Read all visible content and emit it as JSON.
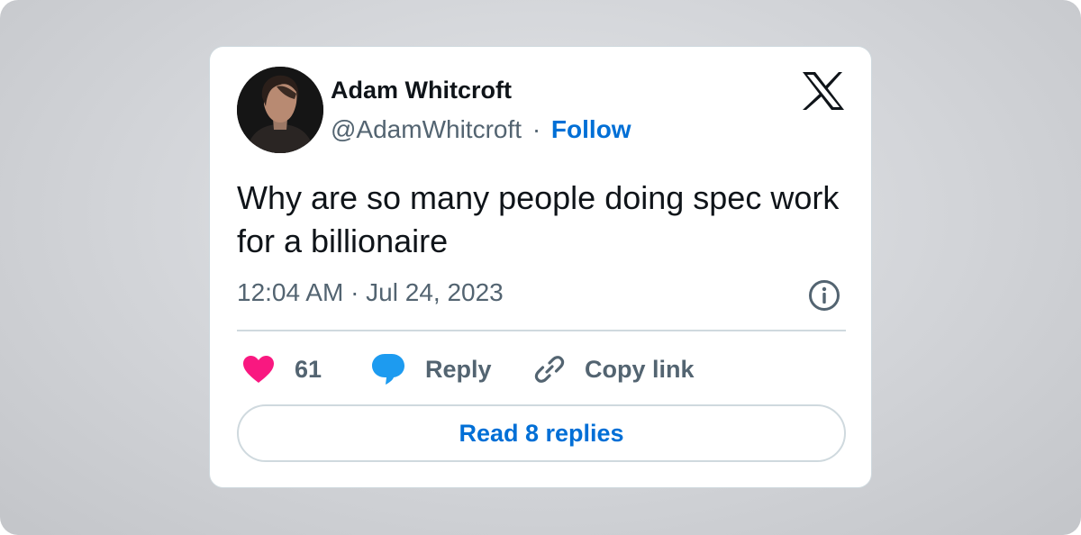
{
  "tweet": {
    "author": {
      "name": "Adam Whitcroft",
      "handle": "@AdamWhitcroft",
      "separator": "·",
      "follow_label": "Follow",
      "avatar_icon": "profile-photo"
    },
    "platform_icon": "x-logo-icon",
    "text": "Why are so many people doing spec work for a billionaire",
    "timestamp": "12:04 AM · Jul 24, 2023",
    "info_icon": "info-icon",
    "actions": {
      "like_count": "61",
      "reply_label": "Reply",
      "copy_link_label": "Copy link"
    },
    "read_replies_label": "Read 8 replies"
  },
  "colors": {
    "link_blue": "#006fd6",
    "heart_pink": "#f91880",
    "reply_blue": "#1d9bf0",
    "secondary_text": "#536471",
    "primary_text": "#0f1419",
    "border": "#cfd9de"
  }
}
